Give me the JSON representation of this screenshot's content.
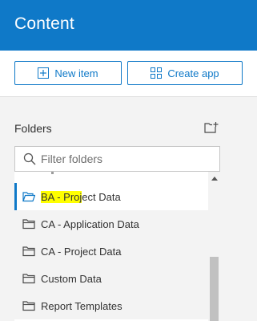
{
  "header": {
    "title": "Content"
  },
  "actions": {
    "new_item_label": "New item",
    "create_app_label": "Create app"
  },
  "folders": {
    "section_label": "Folders",
    "search_placeholder": "Filter folders",
    "items": [
      {
        "label_highlight": "BA - Proj",
        "label_rest": "ect Data",
        "selected": true,
        "icon": "folder-open-icon"
      },
      {
        "label": "CA - Application Data",
        "icon": "folder-icon"
      },
      {
        "label": "CA - Project Data",
        "icon": "folder-icon"
      },
      {
        "label": "Custom Data",
        "icon": "folder-icon"
      },
      {
        "label": "Report Templates",
        "icon": "folder-icon"
      }
    ]
  },
  "colors": {
    "brand_blue": "#0f79c8",
    "highlight_yellow": "#ffff00",
    "panel_bg": "#f3f3f3"
  }
}
